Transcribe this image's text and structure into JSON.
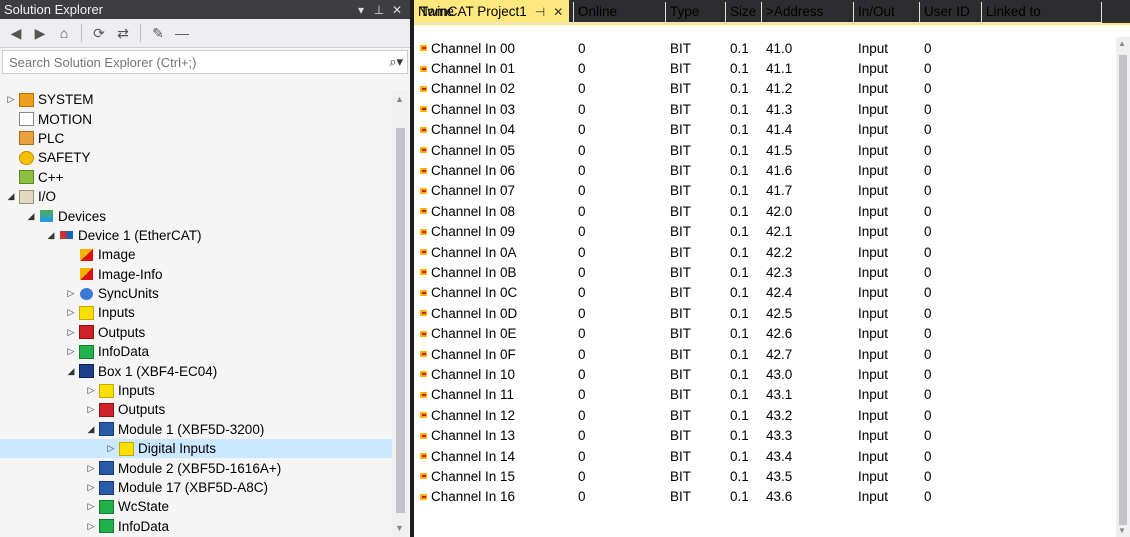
{
  "solution_explorer": {
    "title": "Solution Explorer",
    "header_buttons": [
      "▾",
      "⊥",
      "✕"
    ],
    "search_placeholder": "Search Solution Explorer (Ctrl+;)",
    "tree": [
      {
        "label": "SYSTEM",
        "indent": 1,
        "arrow": "▷",
        "icon": "system-icon"
      },
      {
        "label": "MOTION",
        "indent": 1,
        "arrow": "",
        "icon": "motion-icon"
      },
      {
        "label": "PLC",
        "indent": 1,
        "arrow": "",
        "icon": "plc-icon"
      },
      {
        "label": "SAFETY",
        "indent": 1,
        "arrow": "",
        "icon": "safety-icon"
      },
      {
        "label": "C++",
        "indent": 1,
        "arrow": "",
        "icon": "cpp-icon"
      },
      {
        "label": "I/O",
        "indent": 1,
        "arrow": "◢",
        "icon": "io-icon"
      },
      {
        "label": "Devices",
        "indent": 2,
        "arrow": "◢",
        "icon": "devices-icon"
      },
      {
        "label": "Device 1 (EtherCAT)",
        "indent": 3,
        "arrow": "◢",
        "icon": "ethercat-icon"
      },
      {
        "label": "Image",
        "indent": 4,
        "arrow": "",
        "icon": "image-icon"
      },
      {
        "label": "Image-Info",
        "indent": 4,
        "arrow": "",
        "icon": "image-info-icon"
      },
      {
        "label": "SyncUnits",
        "indent": 4,
        "arrow": "▷",
        "icon": "sync-icon"
      },
      {
        "label": "Inputs",
        "indent": 4,
        "arrow": "▷",
        "icon": "inputs-icon"
      },
      {
        "label": "Outputs",
        "indent": 4,
        "arrow": "▷",
        "icon": "outputs-icon"
      },
      {
        "label": "InfoData",
        "indent": 4,
        "arrow": "▷",
        "icon": "infodata-icon"
      },
      {
        "label": "Box 1 (XBF4-EC04)",
        "indent": 4,
        "arrow": "◢",
        "icon": "box-icon"
      },
      {
        "label": "Inputs",
        "indent": 5,
        "arrow": "▷",
        "icon": "inputs-icon"
      },
      {
        "label": "Outputs",
        "indent": 5,
        "arrow": "▷",
        "icon": "outputs-icon"
      },
      {
        "label": "Module 1 (XBF5D-3200)",
        "indent": 5,
        "arrow": "◢",
        "icon": "module-icon"
      },
      {
        "label": "Digital Inputs",
        "indent": 6,
        "arrow": "▷",
        "icon": "inputs-icon",
        "selected": true
      },
      {
        "label": "Module 2 (XBF5D-1616A+)",
        "indent": 5,
        "arrow": "▷",
        "icon": "module-icon"
      },
      {
        "label": "Module 17 (XBF5D-A8C)",
        "indent": 5,
        "arrow": "▷",
        "icon": "module-icon"
      },
      {
        "label": "WcState",
        "indent": 5,
        "arrow": "▷",
        "icon": "wcstate-icon"
      },
      {
        "label": "InfoData",
        "indent": 5,
        "arrow": "▷",
        "icon": "infodata-icon"
      }
    ]
  },
  "editor": {
    "tab_title": "TwinCAT Project1",
    "tab_pin": "⊣",
    "tab_close": "✕",
    "columns": [
      "Name",
      "Online",
      "Type",
      "Size",
      ">Address",
      "In/Out",
      "User ID",
      "Linked to"
    ],
    "rows": [
      [
        "Channel In 00",
        "0",
        "BIT",
        "0.1",
        "41.0",
        "Input",
        "0",
        ""
      ],
      [
        "Channel In 01",
        "0",
        "BIT",
        "0.1",
        "41.1",
        "Input",
        "0",
        ""
      ],
      [
        "Channel In 02",
        "0",
        "BIT",
        "0.1",
        "41.2",
        "Input",
        "0",
        ""
      ],
      [
        "Channel In 03",
        "0",
        "BIT",
        "0.1",
        "41.3",
        "Input",
        "0",
        ""
      ],
      [
        "Channel In 04",
        "0",
        "BIT",
        "0.1",
        "41.4",
        "Input",
        "0",
        ""
      ],
      [
        "Channel In 05",
        "0",
        "BIT",
        "0.1",
        "41.5",
        "Input",
        "0",
        ""
      ],
      [
        "Channel In 06",
        "0",
        "BIT",
        "0.1",
        "41.6",
        "Input",
        "0",
        ""
      ],
      [
        "Channel In 07",
        "0",
        "BIT",
        "0.1",
        "41.7",
        "Input",
        "0",
        ""
      ],
      [
        "Channel In 08",
        "0",
        "BIT",
        "0.1",
        "42.0",
        "Input",
        "0",
        ""
      ],
      [
        "Channel In 09",
        "0",
        "BIT",
        "0.1",
        "42.1",
        "Input",
        "0",
        ""
      ],
      [
        "Channel In 0A",
        "0",
        "BIT",
        "0.1",
        "42.2",
        "Input",
        "0",
        ""
      ],
      [
        "Channel In 0B",
        "0",
        "BIT",
        "0.1",
        "42.3",
        "Input",
        "0",
        ""
      ],
      [
        "Channel In 0C",
        "0",
        "BIT",
        "0.1",
        "42.4",
        "Input",
        "0",
        ""
      ],
      [
        "Channel In 0D",
        "0",
        "BIT",
        "0.1",
        "42.5",
        "Input",
        "0",
        ""
      ],
      [
        "Channel In 0E",
        "0",
        "BIT",
        "0.1",
        "42.6",
        "Input",
        "0",
        ""
      ],
      [
        "Channel In 0F",
        "0",
        "BIT",
        "0.1",
        "42.7",
        "Input",
        "0",
        ""
      ],
      [
        "Channel In 10",
        "0",
        "BIT",
        "0.1",
        "43.0",
        "Input",
        "0",
        ""
      ],
      [
        "Channel In 11",
        "0",
        "BIT",
        "0.1",
        "43.1",
        "Input",
        "0",
        ""
      ],
      [
        "Channel In 12",
        "0",
        "BIT",
        "0.1",
        "43.2",
        "Input",
        "0",
        ""
      ],
      [
        "Channel In 13",
        "0",
        "BIT",
        "0.1",
        "43.3",
        "Input",
        "0",
        ""
      ],
      [
        "Channel In 14",
        "0",
        "BIT",
        "0.1",
        "43.4",
        "Input",
        "0",
        ""
      ],
      [
        "Channel In 15",
        "0",
        "BIT",
        "0.1",
        "43.5",
        "Input",
        "0",
        ""
      ],
      [
        "Channel In 16",
        "0",
        "BIT",
        "0.1",
        "43.6",
        "Input",
        "0",
        ""
      ]
    ]
  },
  "colors": {
    "tab_accent": "#ffe97f",
    "selection": "#cce8ff",
    "header_bg": "#3e3e42"
  }
}
